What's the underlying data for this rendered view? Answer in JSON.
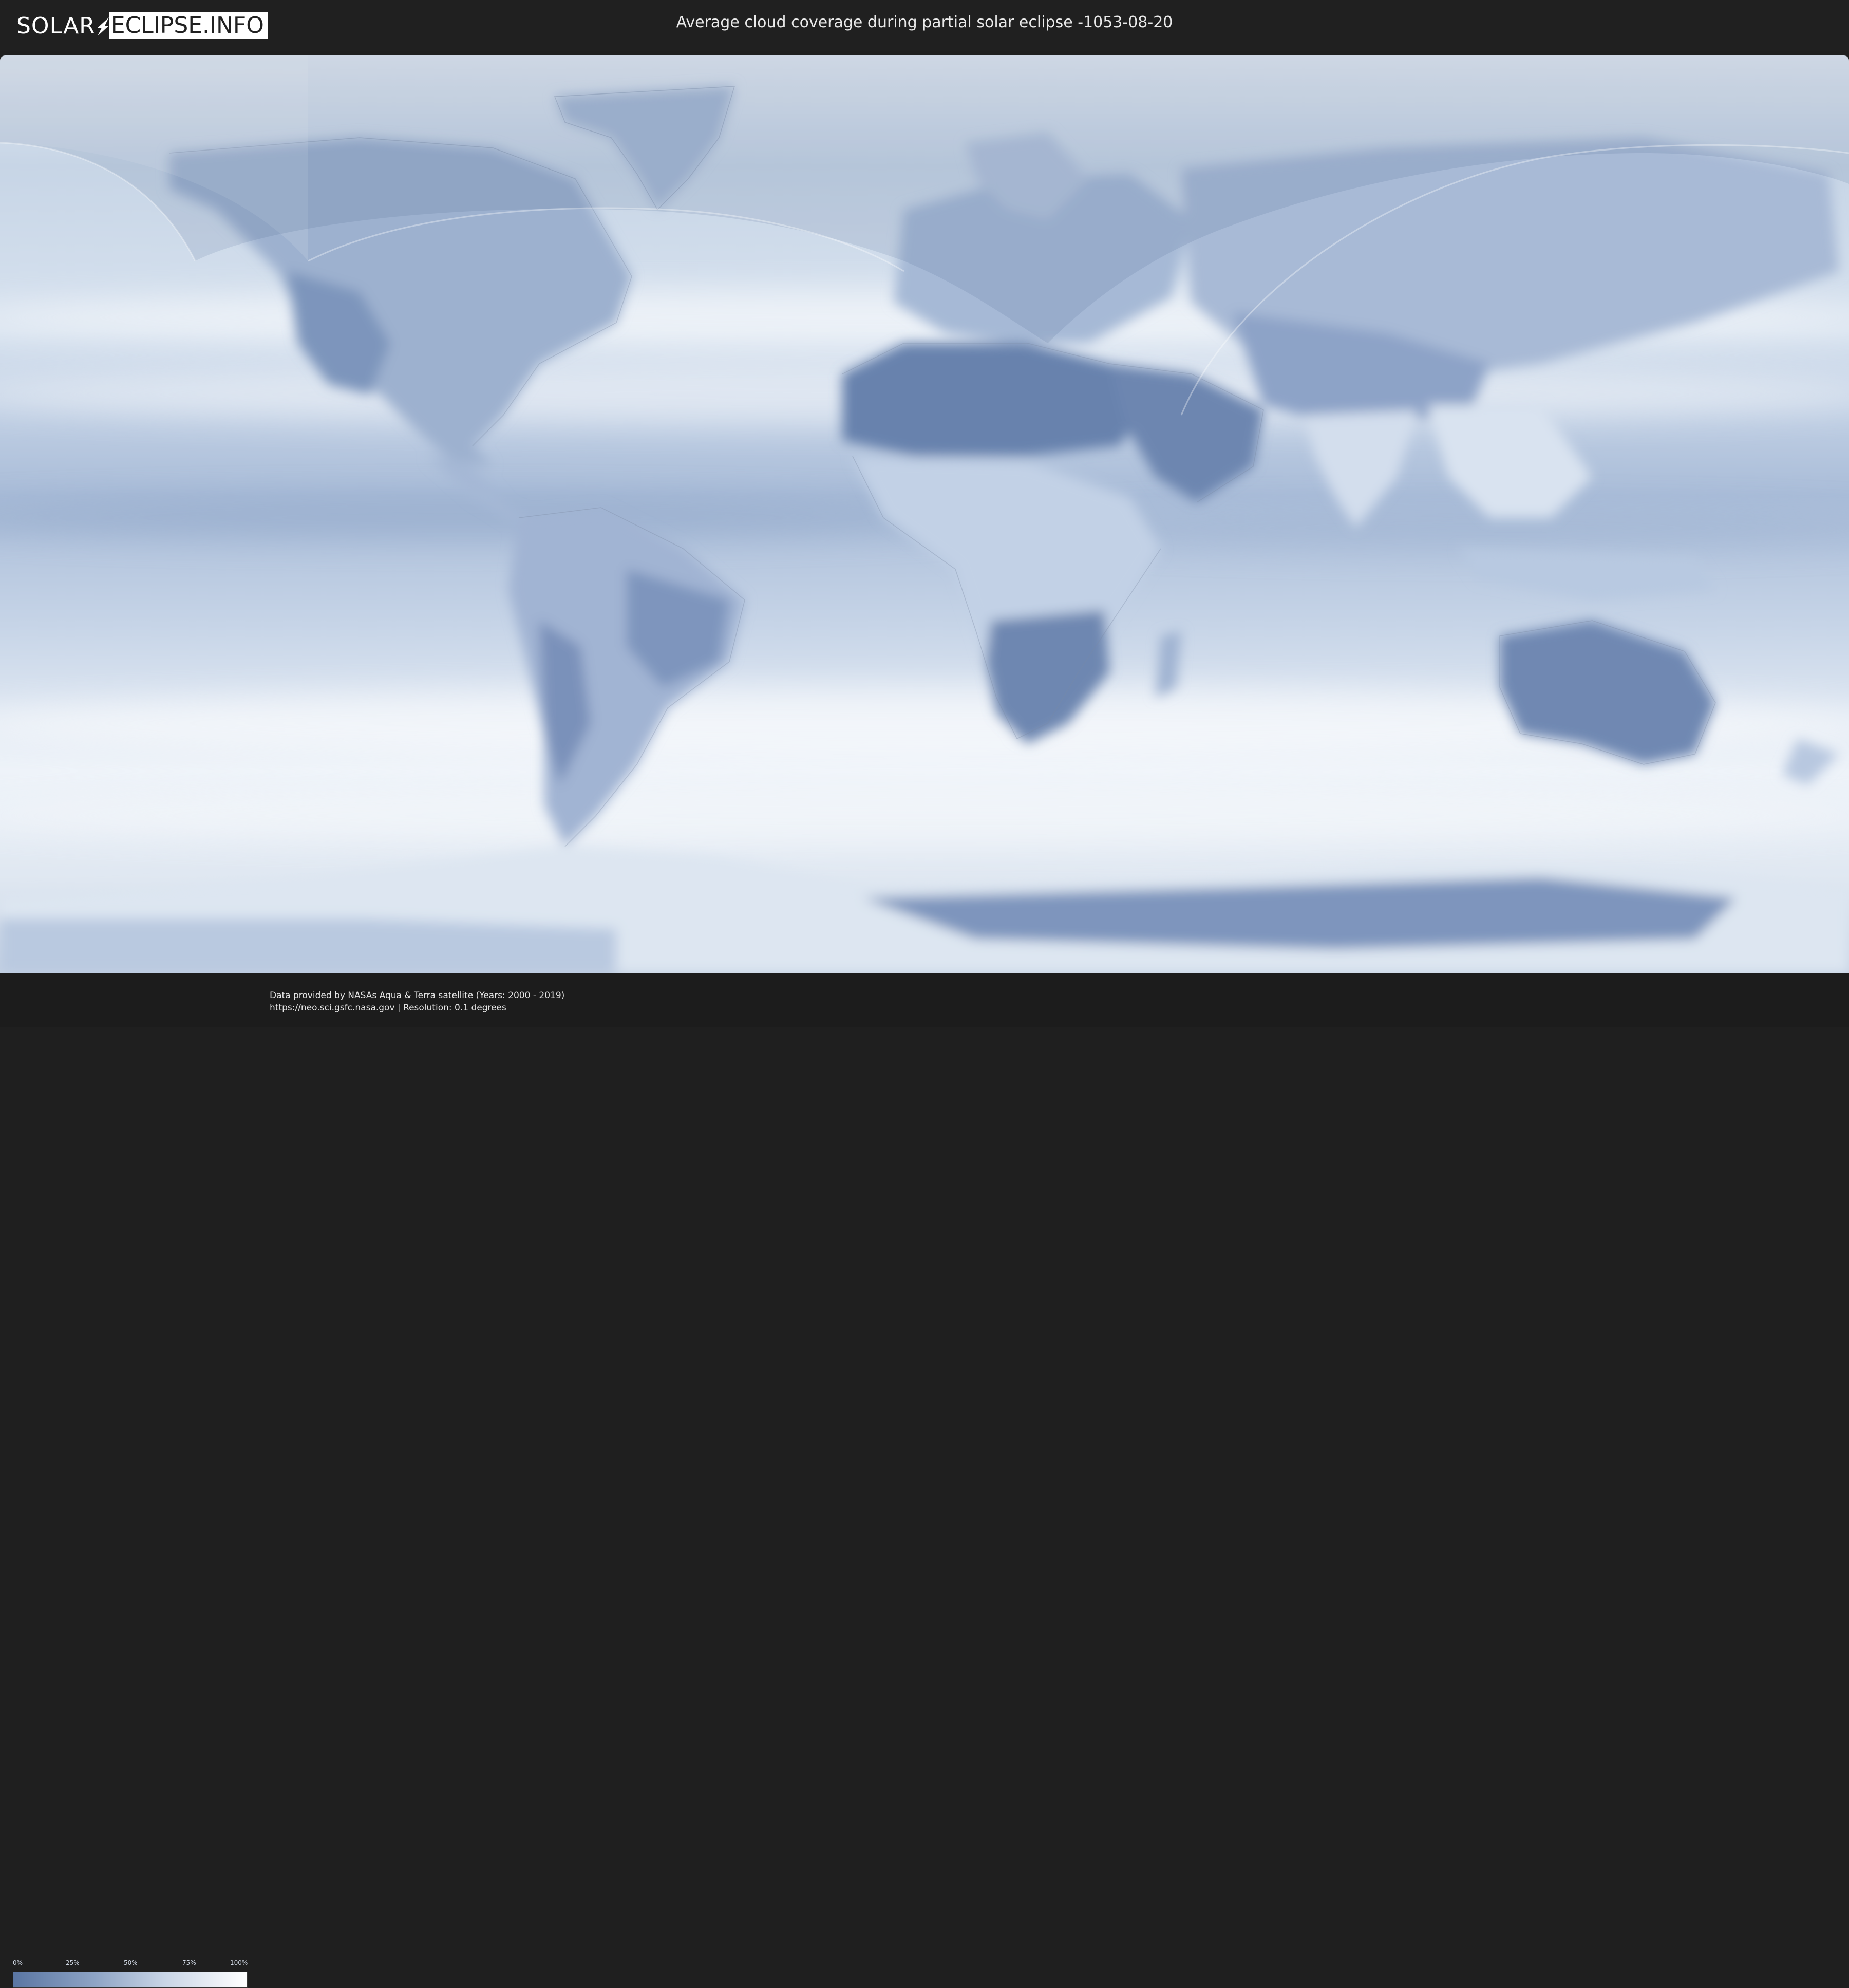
{
  "logo": {
    "part1": "SOLAR",
    "part2": "ECLIPSE.INFO"
  },
  "title": "Average cloud coverage during partial solar eclipse -1053-08-20",
  "legend": {
    "ticks": [
      "0%",
      "25%",
      "50%",
      "75%",
      "100%"
    ],
    "color_low": "#5a76a3",
    "color_high": "#ffffff"
  },
  "credits": {
    "line1": "Data provided by NASAs Aqua & Terra satellite (Years: 2000 - 2019)",
    "line2": "https://neo.sci.gsfc.nasa.gov | Resolution: 0.1 degrees"
  },
  "colors": {
    "ocean_light": "#dde7f3",
    "land_dark": "#6f88b1",
    "eclipse_overlay": "#ffffff"
  }
}
